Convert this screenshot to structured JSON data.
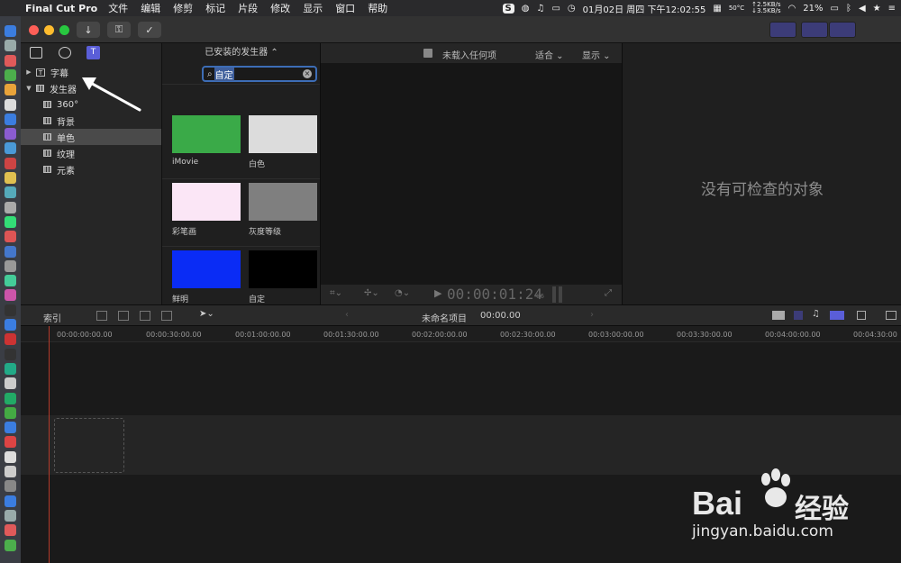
{
  "menubar": {
    "app_name": "Final Cut Pro",
    "items": [
      "文件",
      "编辑",
      "修剪",
      "标记",
      "片段",
      "修改",
      "显示",
      "窗口",
      "帮助"
    ],
    "temp": "50°C",
    "net_up": "↑2.5KB/s",
    "net_down": "↓3.5KB/s",
    "datetime": "01月02日 周四 下午12:02:55",
    "battery": "21%"
  },
  "sidebar": {
    "items": [
      {
        "label": "字幕"
      },
      {
        "label": "发生器"
      },
      {
        "label": "360°"
      },
      {
        "label": "背景"
      },
      {
        "label": "单色"
      },
      {
        "label": "纹理"
      },
      {
        "label": "元素"
      }
    ]
  },
  "browser": {
    "header": "已安装的发生器 ⌃",
    "search_value": "自定",
    "thumbnails": [
      {
        "label": "iMovie",
        "color": "#3aaa48"
      },
      {
        "label": "白色",
        "color": "#dcdcdc"
      },
      {
        "label": "彩笔画",
        "color": "#fbe6f6"
      },
      {
        "label": "灰度等级",
        "color": "#7f7f7f"
      },
      {
        "label": "鲜明",
        "color": "#0a2cf5"
      },
      {
        "label": "自定",
        "color": "#000000"
      }
    ]
  },
  "viewer": {
    "title": "未载入任何项",
    "fit_label": "适合 ⌄",
    "display_label": "显示 ⌄",
    "timecode": "00:00:01:24",
    "timecode_frames": "06"
  },
  "inspector": {
    "empty_message": "没有可检查的对象"
  },
  "timeline": {
    "index_label": "索引",
    "project_name": "未命名项目",
    "project_time": "00:00.00",
    "ruler": [
      "00:00:00:00.00",
      "00:00:30:00.00",
      "00:01:00:00.00",
      "00:01:30:00.00",
      "00:02:00:00.00",
      "00:02:30:00.00",
      "00:03:00:00.00",
      "00:03:30:00.00",
      "00:04:00:00.00",
      "00:04:30:00"
    ]
  },
  "watermark": {
    "brand_left": "Bai",
    "brand_right": "经验",
    "url": "jingyan.baidu.com"
  }
}
